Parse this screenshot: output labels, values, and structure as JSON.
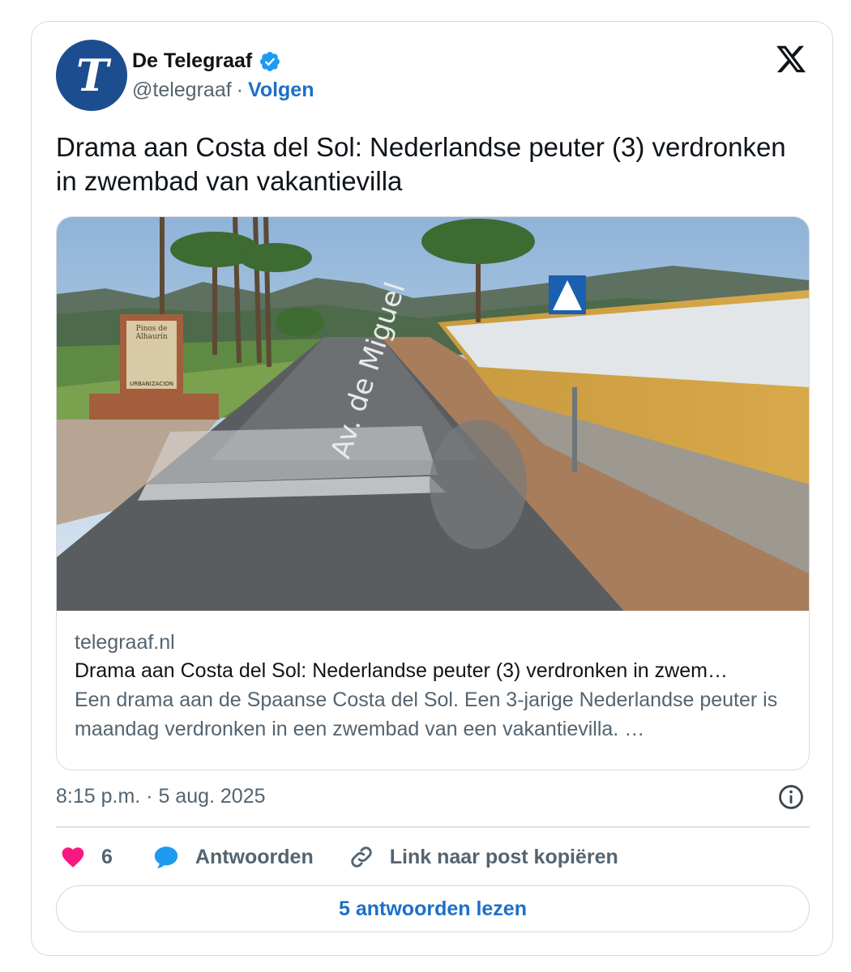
{
  "account": {
    "avatar_letter": "T",
    "name": "De Telegraaf",
    "handle": "@telegraaf",
    "separator": "·",
    "follow_label": "Volgen",
    "brand_color": "#1c4e8f"
  },
  "tweet": {
    "text": "Drama aan Costa del Sol: Nederlandse peuter (3) verdronken in zwembad van vakantievilla"
  },
  "link_card": {
    "domain": "telegraaf.nl",
    "title": "Drama aan Costa del Sol: Nederlandse peuter (3) verdronken in zwem…",
    "description": "Een drama aan de Spaanse Costa del Sol. Een 3-jarige Nederlandse peuter is maandag verdronken in een zwembad van een vakantievilla. …",
    "photo_sign_text": [
      "Pinos de",
      "Alhaurín",
      "URBANIZACION"
    ],
    "road_text": "Av. de Miguel"
  },
  "meta": {
    "timestamp": "8:15 p.m. · 5 aug. 2025"
  },
  "actions": {
    "like_count": "6",
    "reply_label": "Antwoorden",
    "copy_link_label": "Link naar post kopiëren"
  },
  "read_replies_label": "5 antwoorden lezen",
  "colors": {
    "link_blue": "#1d6fc8",
    "like_pink": "#f91880",
    "reply_blue": "#1d9bf0",
    "secondary_text": "#536471"
  }
}
